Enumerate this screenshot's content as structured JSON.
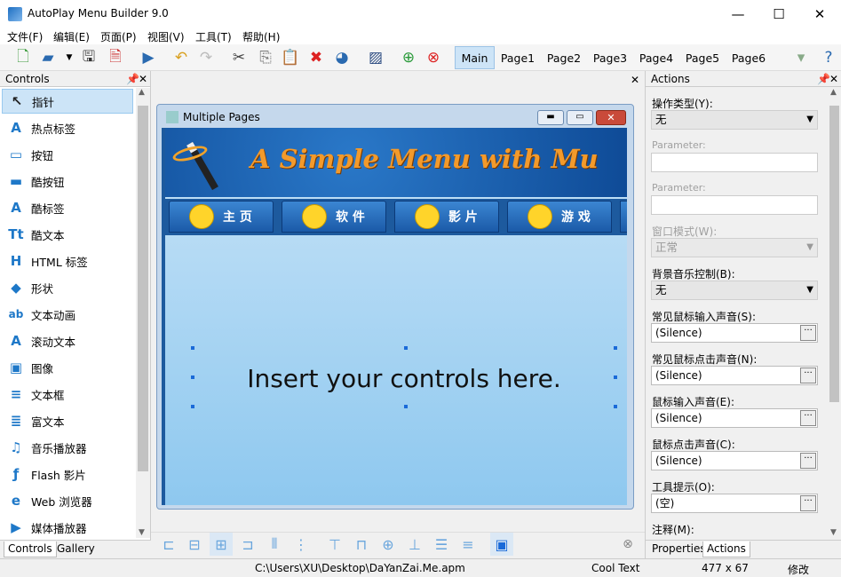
{
  "window": {
    "title": "AutoPlay Menu Builder 9.0",
    "minimize": "—",
    "maximize": "☐",
    "close": "✕"
  },
  "menu": [
    "文件(F)",
    "编辑(E)",
    "页面(P)",
    "视图(V)",
    "工具(T)",
    "帮助(H)"
  ],
  "page_tabs": [
    "Main",
    "Page1",
    "Page2",
    "Page3",
    "Page4",
    "Page5",
    "Page6"
  ],
  "controls_panel": {
    "title": "Controls",
    "items": [
      {
        "label": "指针",
        "icon": "pointer-icon",
        "glyph": "↖"
      },
      {
        "label": "热点标签",
        "icon": "hotspot-label-icon",
        "glyph": "A"
      },
      {
        "label": "按钮",
        "icon": "button-icon",
        "glyph": "▭"
      },
      {
        "label": "酷按钮",
        "icon": "cool-button-icon",
        "glyph": "▬"
      },
      {
        "label": "酷标签",
        "icon": "cool-label-icon",
        "glyph": "A"
      },
      {
        "label": "酷文本",
        "icon": "cool-text-icon",
        "glyph": "Tt"
      },
      {
        "label": "HTML 标签",
        "icon": "html-label-icon",
        "glyph": "H"
      },
      {
        "label": "形状",
        "icon": "shape-icon",
        "glyph": "◆"
      },
      {
        "label": "文本动画",
        "icon": "text-animation-icon",
        "glyph": "ab"
      },
      {
        "label": "滚动文本",
        "icon": "scroll-text-icon",
        "glyph": "A"
      },
      {
        "label": "图像",
        "icon": "image-icon",
        "glyph": "▣"
      },
      {
        "label": "文本框",
        "icon": "textbox-icon",
        "glyph": "≡"
      },
      {
        "label": "富文本",
        "icon": "rich-text-icon",
        "glyph": "≣"
      },
      {
        "label": "音乐播放器",
        "icon": "music-player-icon",
        "glyph": "♫"
      },
      {
        "label": "Flash 影片",
        "icon": "flash-movie-icon",
        "glyph": "ƒ"
      },
      {
        "label": "Web 浏览器",
        "icon": "web-browser-icon",
        "glyph": "e"
      },
      {
        "label": "媒体播放器",
        "icon": "media-player-icon",
        "glyph": "▶"
      }
    ],
    "bottom_tabs": [
      "Controls",
      "Gallery"
    ]
  },
  "canvas": {
    "window_title": "Multiple Pages",
    "banner_text": "A Simple Menu  with Mu",
    "nav_tabs": [
      "主 页",
      "软 件",
      "影 片",
      "游 戏"
    ],
    "placeholder": "Insert your controls here."
  },
  "actions_panel": {
    "title": "Actions",
    "fields": [
      {
        "label": "操作类型(Y):",
        "type": "combo",
        "value": "无",
        "disabled": false
      },
      {
        "label": "Parameter:",
        "type": "text",
        "value": "",
        "disabled": true
      },
      {
        "label": "Parameter:",
        "type": "text",
        "value": "",
        "disabled": true
      },
      {
        "label": "窗口模式(W):",
        "type": "combo",
        "value": "正常",
        "disabled": true
      },
      {
        "label": "背景音乐控制(B):",
        "type": "combo",
        "value": "无",
        "disabled": false
      },
      {
        "label": "常见鼠标输入声音(S):",
        "type": "browse",
        "value": "(Silence)",
        "disabled": false
      },
      {
        "label": "常见鼠标点击声音(N):",
        "type": "browse",
        "value": "(Silence)",
        "disabled": false
      },
      {
        "label": "鼠标输入声音(E):",
        "type": "browse",
        "value": "(Silence)",
        "disabled": false
      },
      {
        "label": "鼠标点击声音(C):",
        "type": "browse",
        "value": "(Silence)",
        "disabled": false
      },
      {
        "label": "工具提示(O):",
        "type": "browse",
        "value": "(空)",
        "disabled": false
      },
      {
        "label": "注释(M):",
        "type": "label",
        "value": "",
        "disabled": false
      }
    ],
    "bottom_tabs": [
      "Properties",
      "Actions"
    ]
  },
  "status": {
    "path": "C:\\Users\\XU\\Desktop\\DaYanZai.Me.apm",
    "font": "Cool Text",
    "size": "477 x 67",
    "state": "修改"
  },
  "colors": {
    "accent": "#cce4f7",
    "banner": "#1356a8",
    "canvas_bg": "#b8dcf4"
  }
}
